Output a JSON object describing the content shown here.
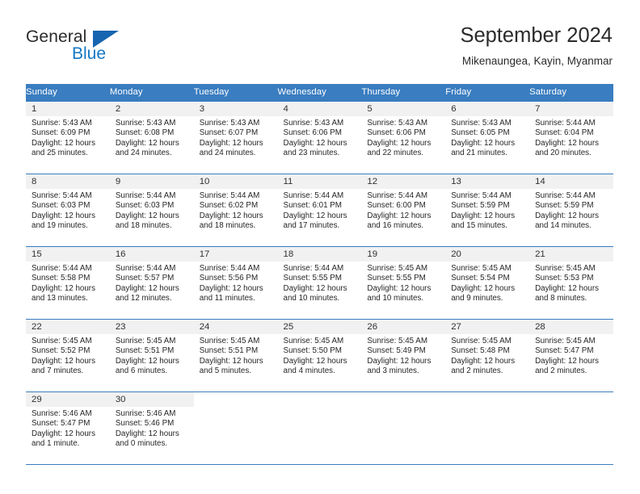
{
  "brand": {
    "name_part1": "General",
    "name_part2": "Blue",
    "triangle_color": "#1565b0",
    "blue_color": "#1577c4"
  },
  "header": {
    "title": "September 2024",
    "subtitle": "Mikenaungea, Kayin, Myanmar"
  },
  "theme": {
    "header_row_bg": "#3a7dc0",
    "header_row_text": "#ffffff",
    "date_band_bg": "#f1f1f1",
    "grid_line": "#3a7dc0",
    "body_text": "#262626"
  },
  "weekdays": [
    "Sunday",
    "Monday",
    "Tuesday",
    "Wednesday",
    "Thursday",
    "Friday",
    "Saturday"
  ],
  "weeks": [
    [
      {
        "date": "1",
        "sunrise": "Sunrise: 5:43 AM",
        "sunset": "Sunset: 6:09 PM",
        "daylight_line1": "Daylight: 12 hours",
        "daylight_line2": "and 25 minutes."
      },
      {
        "date": "2",
        "sunrise": "Sunrise: 5:43 AM",
        "sunset": "Sunset: 6:08 PM",
        "daylight_line1": "Daylight: 12 hours",
        "daylight_line2": "and 24 minutes."
      },
      {
        "date": "3",
        "sunrise": "Sunrise: 5:43 AM",
        "sunset": "Sunset: 6:07 PM",
        "daylight_line1": "Daylight: 12 hours",
        "daylight_line2": "and 24 minutes."
      },
      {
        "date": "4",
        "sunrise": "Sunrise: 5:43 AM",
        "sunset": "Sunset: 6:06 PM",
        "daylight_line1": "Daylight: 12 hours",
        "daylight_line2": "and 23 minutes."
      },
      {
        "date": "5",
        "sunrise": "Sunrise: 5:43 AM",
        "sunset": "Sunset: 6:06 PM",
        "daylight_line1": "Daylight: 12 hours",
        "daylight_line2": "and 22 minutes."
      },
      {
        "date": "6",
        "sunrise": "Sunrise: 5:43 AM",
        "sunset": "Sunset: 6:05 PM",
        "daylight_line1": "Daylight: 12 hours",
        "daylight_line2": "and 21 minutes."
      },
      {
        "date": "7",
        "sunrise": "Sunrise: 5:44 AM",
        "sunset": "Sunset: 6:04 PM",
        "daylight_line1": "Daylight: 12 hours",
        "daylight_line2": "and 20 minutes."
      }
    ],
    [
      {
        "date": "8",
        "sunrise": "Sunrise: 5:44 AM",
        "sunset": "Sunset: 6:03 PM",
        "daylight_line1": "Daylight: 12 hours",
        "daylight_line2": "and 19 minutes."
      },
      {
        "date": "9",
        "sunrise": "Sunrise: 5:44 AM",
        "sunset": "Sunset: 6:03 PM",
        "daylight_line1": "Daylight: 12 hours",
        "daylight_line2": "and 18 minutes."
      },
      {
        "date": "10",
        "sunrise": "Sunrise: 5:44 AM",
        "sunset": "Sunset: 6:02 PM",
        "daylight_line1": "Daylight: 12 hours",
        "daylight_line2": "and 18 minutes."
      },
      {
        "date": "11",
        "sunrise": "Sunrise: 5:44 AM",
        "sunset": "Sunset: 6:01 PM",
        "daylight_line1": "Daylight: 12 hours",
        "daylight_line2": "and 17 minutes."
      },
      {
        "date": "12",
        "sunrise": "Sunrise: 5:44 AM",
        "sunset": "Sunset: 6:00 PM",
        "daylight_line1": "Daylight: 12 hours",
        "daylight_line2": "and 16 minutes."
      },
      {
        "date": "13",
        "sunrise": "Sunrise: 5:44 AM",
        "sunset": "Sunset: 5:59 PM",
        "daylight_line1": "Daylight: 12 hours",
        "daylight_line2": "and 15 minutes."
      },
      {
        "date": "14",
        "sunrise": "Sunrise: 5:44 AM",
        "sunset": "Sunset: 5:59 PM",
        "daylight_line1": "Daylight: 12 hours",
        "daylight_line2": "and 14 minutes."
      }
    ],
    [
      {
        "date": "15",
        "sunrise": "Sunrise: 5:44 AM",
        "sunset": "Sunset: 5:58 PM",
        "daylight_line1": "Daylight: 12 hours",
        "daylight_line2": "and 13 minutes."
      },
      {
        "date": "16",
        "sunrise": "Sunrise: 5:44 AM",
        "sunset": "Sunset: 5:57 PM",
        "daylight_line1": "Daylight: 12 hours",
        "daylight_line2": "and 12 minutes."
      },
      {
        "date": "17",
        "sunrise": "Sunrise: 5:44 AM",
        "sunset": "Sunset: 5:56 PM",
        "daylight_line1": "Daylight: 12 hours",
        "daylight_line2": "and 11 minutes."
      },
      {
        "date": "18",
        "sunrise": "Sunrise: 5:44 AM",
        "sunset": "Sunset: 5:55 PM",
        "daylight_line1": "Daylight: 12 hours",
        "daylight_line2": "and 10 minutes."
      },
      {
        "date": "19",
        "sunrise": "Sunrise: 5:45 AM",
        "sunset": "Sunset: 5:55 PM",
        "daylight_line1": "Daylight: 12 hours",
        "daylight_line2": "and 10 minutes."
      },
      {
        "date": "20",
        "sunrise": "Sunrise: 5:45 AM",
        "sunset": "Sunset: 5:54 PM",
        "daylight_line1": "Daylight: 12 hours",
        "daylight_line2": "and 9 minutes."
      },
      {
        "date": "21",
        "sunrise": "Sunrise: 5:45 AM",
        "sunset": "Sunset: 5:53 PM",
        "daylight_line1": "Daylight: 12 hours",
        "daylight_line2": "and 8 minutes."
      }
    ],
    [
      {
        "date": "22",
        "sunrise": "Sunrise: 5:45 AM",
        "sunset": "Sunset: 5:52 PM",
        "daylight_line1": "Daylight: 12 hours",
        "daylight_line2": "and 7 minutes."
      },
      {
        "date": "23",
        "sunrise": "Sunrise: 5:45 AM",
        "sunset": "Sunset: 5:51 PM",
        "daylight_line1": "Daylight: 12 hours",
        "daylight_line2": "and 6 minutes."
      },
      {
        "date": "24",
        "sunrise": "Sunrise: 5:45 AM",
        "sunset": "Sunset: 5:51 PM",
        "daylight_line1": "Daylight: 12 hours",
        "daylight_line2": "and 5 minutes."
      },
      {
        "date": "25",
        "sunrise": "Sunrise: 5:45 AM",
        "sunset": "Sunset: 5:50 PM",
        "daylight_line1": "Daylight: 12 hours",
        "daylight_line2": "and 4 minutes."
      },
      {
        "date": "26",
        "sunrise": "Sunrise: 5:45 AM",
        "sunset": "Sunset: 5:49 PM",
        "daylight_line1": "Daylight: 12 hours",
        "daylight_line2": "and 3 minutes."
      },
      {
        "date": "27",
        "sunrise": "Sunrise: 5:45 AM",
        "sunset": "Sunset: 5:48 PM",
        "daylight_line1": "Daylight: 12 hours",
        "daylight_line2": "and 2 minutes."
      },
      {
        "date": "28",
        "sunrise": "Sunrise: 5:45 AM",
        "sunset": "Sunset: 5:47 PM",
        "daylight_line1": "Daylight: 12 hours",
        "daylight_line2": "and 2 minutes."
      }
    ],
    [
      {
        "date": "29",
        "sunrise": "Sunrise: 5:46 AM",
        "sunset": "Sunset: 5:47 PM",
        "daylight_line1": "Daylight: 12 hours",
        "daylight_line2": "and 1 minute."
      },
      {
        "date": "30",
        "sunrise": "Sunrise: 5:46 AM",
        "sunset": "Sunset: 5:46 PM",
        "daylight_line1": "Daylight: 12 hours",
        "daylight_line2": "and 0 minutes."
      },
      {
        "date": "",
        "sunrise": "",
        "sunset": "",
        "daylight_line1": "",
        "daylight_line2": ""
      },
      {
        "date": "",
        "sunrise": "",
        "sunset": "",
        "daylight_line1": "",
        "daylight_line2": ""
      },
      {
        "date": "",
        "sunrise": "",
        "sunset": "",
        "daylight_line1": "",
        "daylight_line2": ""
      },
      {
        "date": "",
        "sunrise": "",
        "sunset": "",
        "daylight_line1": "",
        "daylight_line2": ""
      },
      {
        "date": "",
        "sunrise": "",
        "sunset": "",
        "daylight_line1": "",
        "daylight_line2": ""
      }
    ]
  ]
}
